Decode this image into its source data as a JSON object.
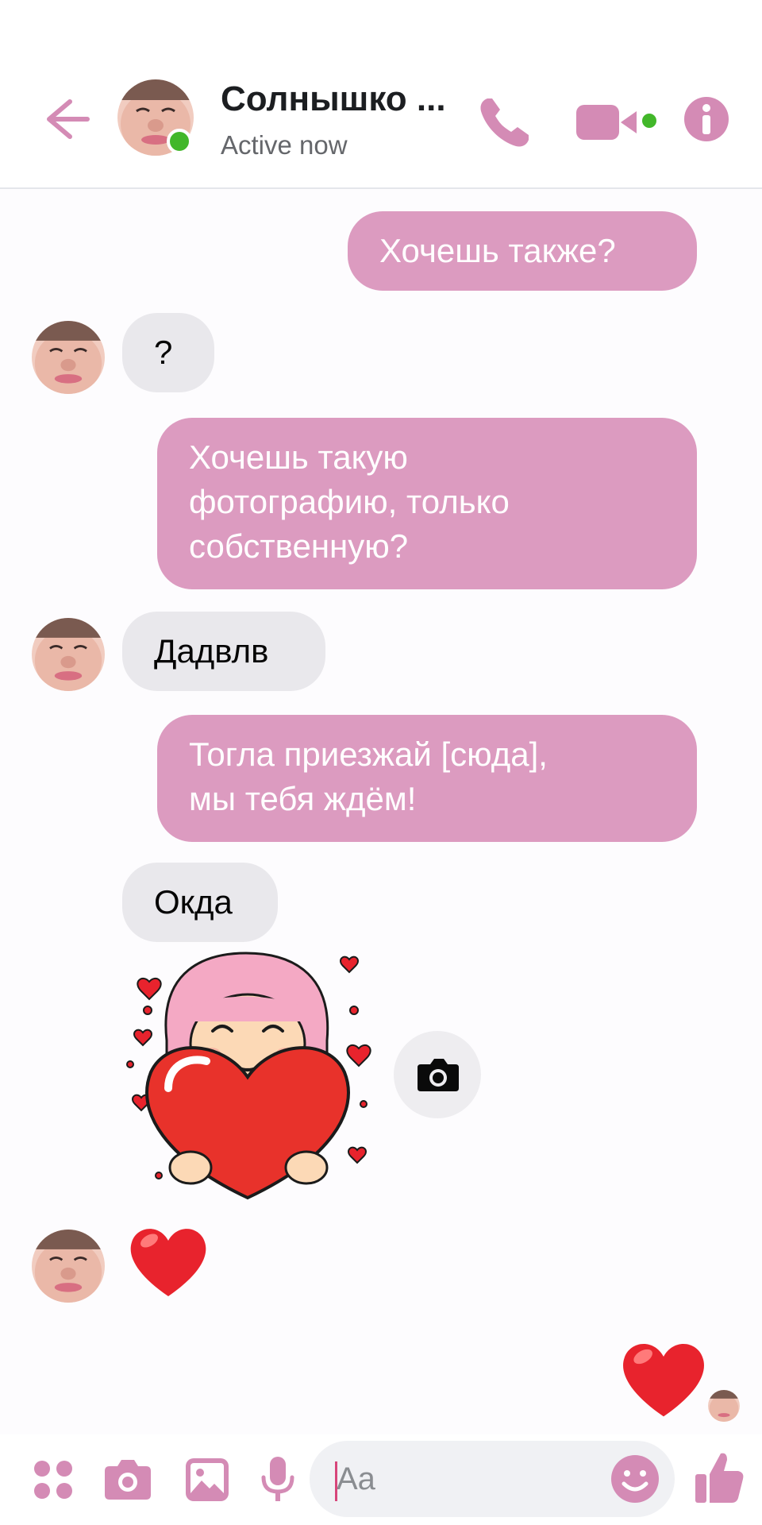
{
  "header": {
    "contact_name": "Солнышко ...",
    "status": "Active now"
  },
  "messages": [
    {
      "dir": "out",
      "text": "Хочешь также?"
    },
    {
      "dir": "in",
      "text": "?"
    },
    {
      "dir": "out",
      "lines": [
        "Хочешь такую",
        "фотографию, только",
        "собственную?"
      ]
    },
    {
      "dir": "in",
      "text": "Дадвлв"
    },
    {
      "dir": "out",
      "lines": [
        "Тогла приезжай [сюда],",
        "мы тебя ждём!"
      ]
    },
    {
      "dir": "in",
      "text": "Окда"
    },
    {
      "dir": "in",
      "type": "sticker",
      "icon": "girl-holding-heart-sticker"
    },
    {
      "dir": "in",
      "type": "emoji",
      "icon": "heart-emoji"
    },
    {
      "dir": "out",
      "type": "emoji",
      "icon": "heart-emoji"
    }
  ],
  "composer": {
    "placeholder": "Aa"
  },
  "colors": {
    "accent": "#dc9bc0",
    "icon": "#d48bb5",
    "online": "#42b72a",
    "incoming_bubble": "#e9e8ec",
    "heart": "#e8232d"
  }
}
